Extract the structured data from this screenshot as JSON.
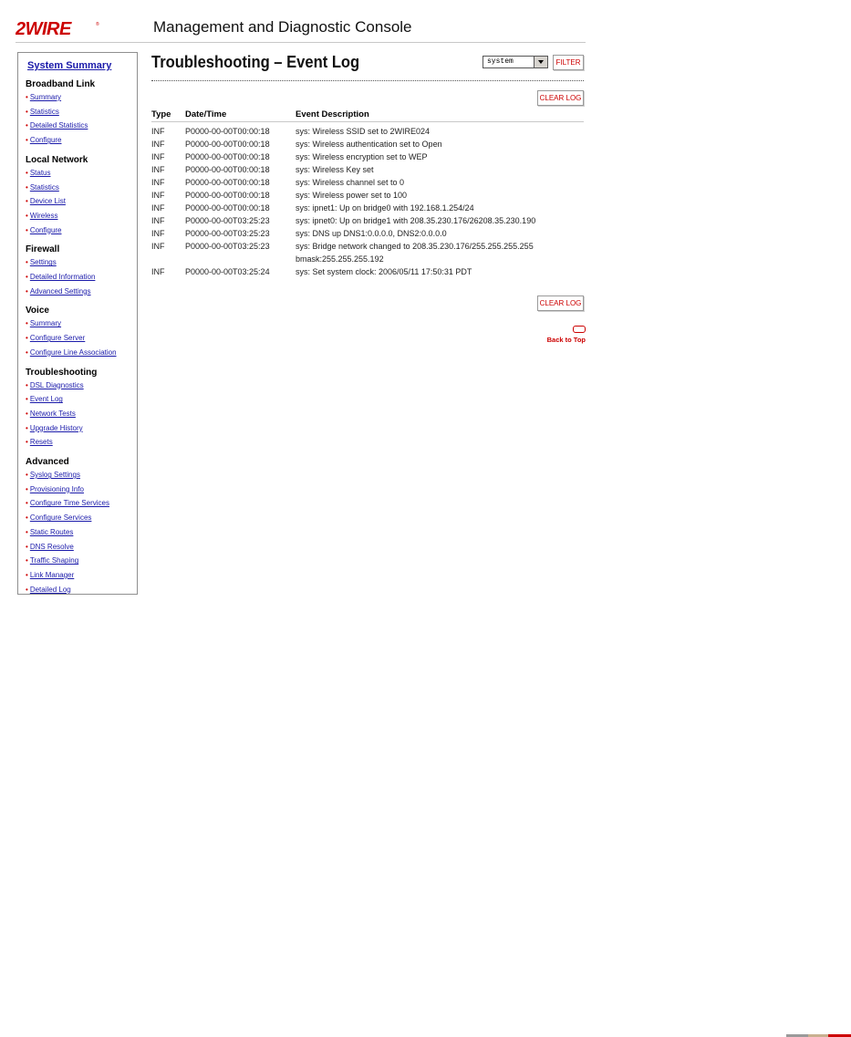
{
  "header": {
    "logo_text": "2WIRE",
    "console_title": "Management and Diagnostic Console"
  },
  "sidebar": {
    "summary_link": "System Summary",
    "sections": [
      {
        "title": "Broadband Link",
        "items": [
          "Summary",
          "Statistics",
          "Detailed Statistics",
          "Configure"
        ]
      },
      {
        "title": "Local Network",
        "items": [
          "Status",
          "Statistics",
          "Device List",
          "Wireless",
          "Configure"
        ]
      },
      {
        "title": "Firewall",
        "items": [
          "Settings",
          "Detailed Information",
          "Advanced Settings"
        ]
      },
      {
        "title": "Voice",
        "items": [
          "Summary",
          "Configure Server",
          "Configure Line Association"
        ]
      },
      {
        "title": "Troubleshooting",
        "items": [
          "DSL Diagnostics",
          "Event Log",
          "Network Tests",
          "Upgrade History",
          "Resets"
        ]
      },
      {
        "title": "Advanced",
        "items": [
          "Syslog Settings",
          "Provisioning Info",
          "Configure Time Services",
          "Configure Services",
          "Static Routes",
          "DNS Resolve",
          "Traffic Shaping",
          "Link Manager",
          "Detailed Log"
        ]
      }
    ]
  },
  "main": {
    "title": "Troubleshooting – Event Log",
    "filter_select_value": "system",
    "filter_button": "FILTER",
    "clear_log_button": "CLEAR LOG",
    "back_to_top": "Back to Top",
    "table": {
      "headers": [
        "Type",
        "Date/Time",
        "Event Description"
      ],
      "rows": [
        [
          "INF",
          "P0000-00-00T00:00:18",
          "sys:  Wireless SSID set to 2WIRE024"
        ],
        [
          "INF",
          "P0000-00-00T00:00:18",
          "sys:  Wireless authentication set to Open"
        ],
        [
          "INF",
          "P0000-00-00T00:00:18",
          "sys:  Wireless encryption set to WEP"
        ],
        [
          "INF",
          "P0000-00-00T00:00:18",
          "sys:  Wireless Key set"
        ],
        [
          "INF",
          "P0000-00-00T00:00:18",
          "sys:  Wireless channel set to 0"
        ],
        [
          "INF",
          "P0000-00-00T00:00:18",
          "sys:  Wireless power set to 100"
        ],
        [
          "INF",
          "P0000-00-00T00:00:18",
          "sys:  ipnet1: Up on bridge0 with 192.168.1.254/24"
        ],
        [
          "INF",
          "P0000-00-00T03:25:23",
          "sys:  ipnet0: Up on bridge1 with 208.35.230.176/26208.35.230.190"
        ],
        [
          "INF",
          "P0000-00-00T03:25:23",
          "sys:  DNS up DNS1:0.0.0.0, DNS2:0.0.0.0"
        ],
        [
          "INF",
          "P0000-00-00T03:25:23",
          "sys:  Bridge network changed to 208.35.230.176/255.255.255.255 bmask:255.255.255.192"
        ],
        [
          "INF",
          "P0000-00-00T03:25:24",
          "sys:  Set system clock: 2006/05/11 17:50:31 PDT"
        ]
      ]
    }
  },
  "colors": {
    "brand_red": "#cc0000",
    "link_blue": "#1a1aaa"
  }
}
